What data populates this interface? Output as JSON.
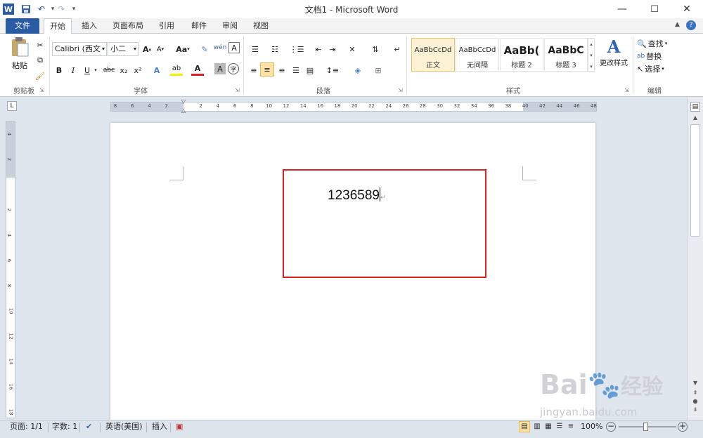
{
  "window": {
    "title": "文档1 - Microsoft Word",
    "controls": {
      "minimize": "—",
      "maximize": "☐",
      "close": "✕"
    }
  },
  "quick_access": {
    "word_logo": "W",
    "save": "💾",
    "undo": "↶",
    "redo": "↷",
    "customize": "▾"
  },
  "tabs": [
    "文件",
    "开始",
    "插入",
    "页面布局",
    "引用",
    "邮件",
    "审阅",
    "视图"
  ],
  "active_tab": "开始",
  "ribbon": {
    "clipboard": {
      "label": "剪贴板",
      "paste": "粘贴"
    },
    "font": {
      "label": "字体",
      "font_name": "Calibri (西文",
      "font_size": "小二",
      "grow": "A",
      "shrink": "A",
      "case": "Aa",
      "bold": "B",
      "italic": "I",
      "underline": "U",
      "strike": "abc",
      "subscript": "x₂",
      "superscript": "x²"
    },
    "paragraph": {
      "label": "段落"
    },
    "styles": {
      "label": "样式",
      "items": [
        {
          "sample": "AaBbCcDd",
          "name": "正文"
        },
        {
          "sample": "AaBbCcDd",
          "name": "无间隔"
        },
        {
          "sample": "AaBb(",
          "name": "标题 2"
        },
        {
          "sample": "AaBbC",
          "name": "标题 3"
        }
      ],
      "change_styles": "更改样式"
    },
    "editing": {
      "label": "编辑",
      "find": "查找",
      "replace": "替换",
      "select": "选择"
    }
  },
  "ruler": {
    "numbers": [
      "8",
      "6",
      "4",
      "2",
      "",
      "2",
      "4",
      "6",
      "8",
      "10",
      "12",
      "14",
      "16",
      "18",
      "20",
      "22",
      "24",
      "26",
      "28",
      "30",
      "32",
      "34",
      "36",
      "38",
      "40",
      "42",
      "44",
      "46",
      "48"
    ]
  },
  "vruler": {
    "numbers": [
      "4",
      "2",
      "",
      "2",
      "4",
      "6",
      "8",
      "10",
      "12",
      "14",
      "16",
      "18"
    ]
  },
  "document": {
    "text": "1236589",
    "para_mark": "↵",
    "highlight_color": "#e02020"
  },
  "statusbar": {
    "page": "页面: 1/1",
    "words": "字数: 1",
    "language": "英语(美国)",
    "mode": "插入",
    "zoom": "100%"
  },
  "watermark": {
    "brand": "Bai",
    "brand2": "经验",
    "url": "jingyan.baidu.com"
  }
}
